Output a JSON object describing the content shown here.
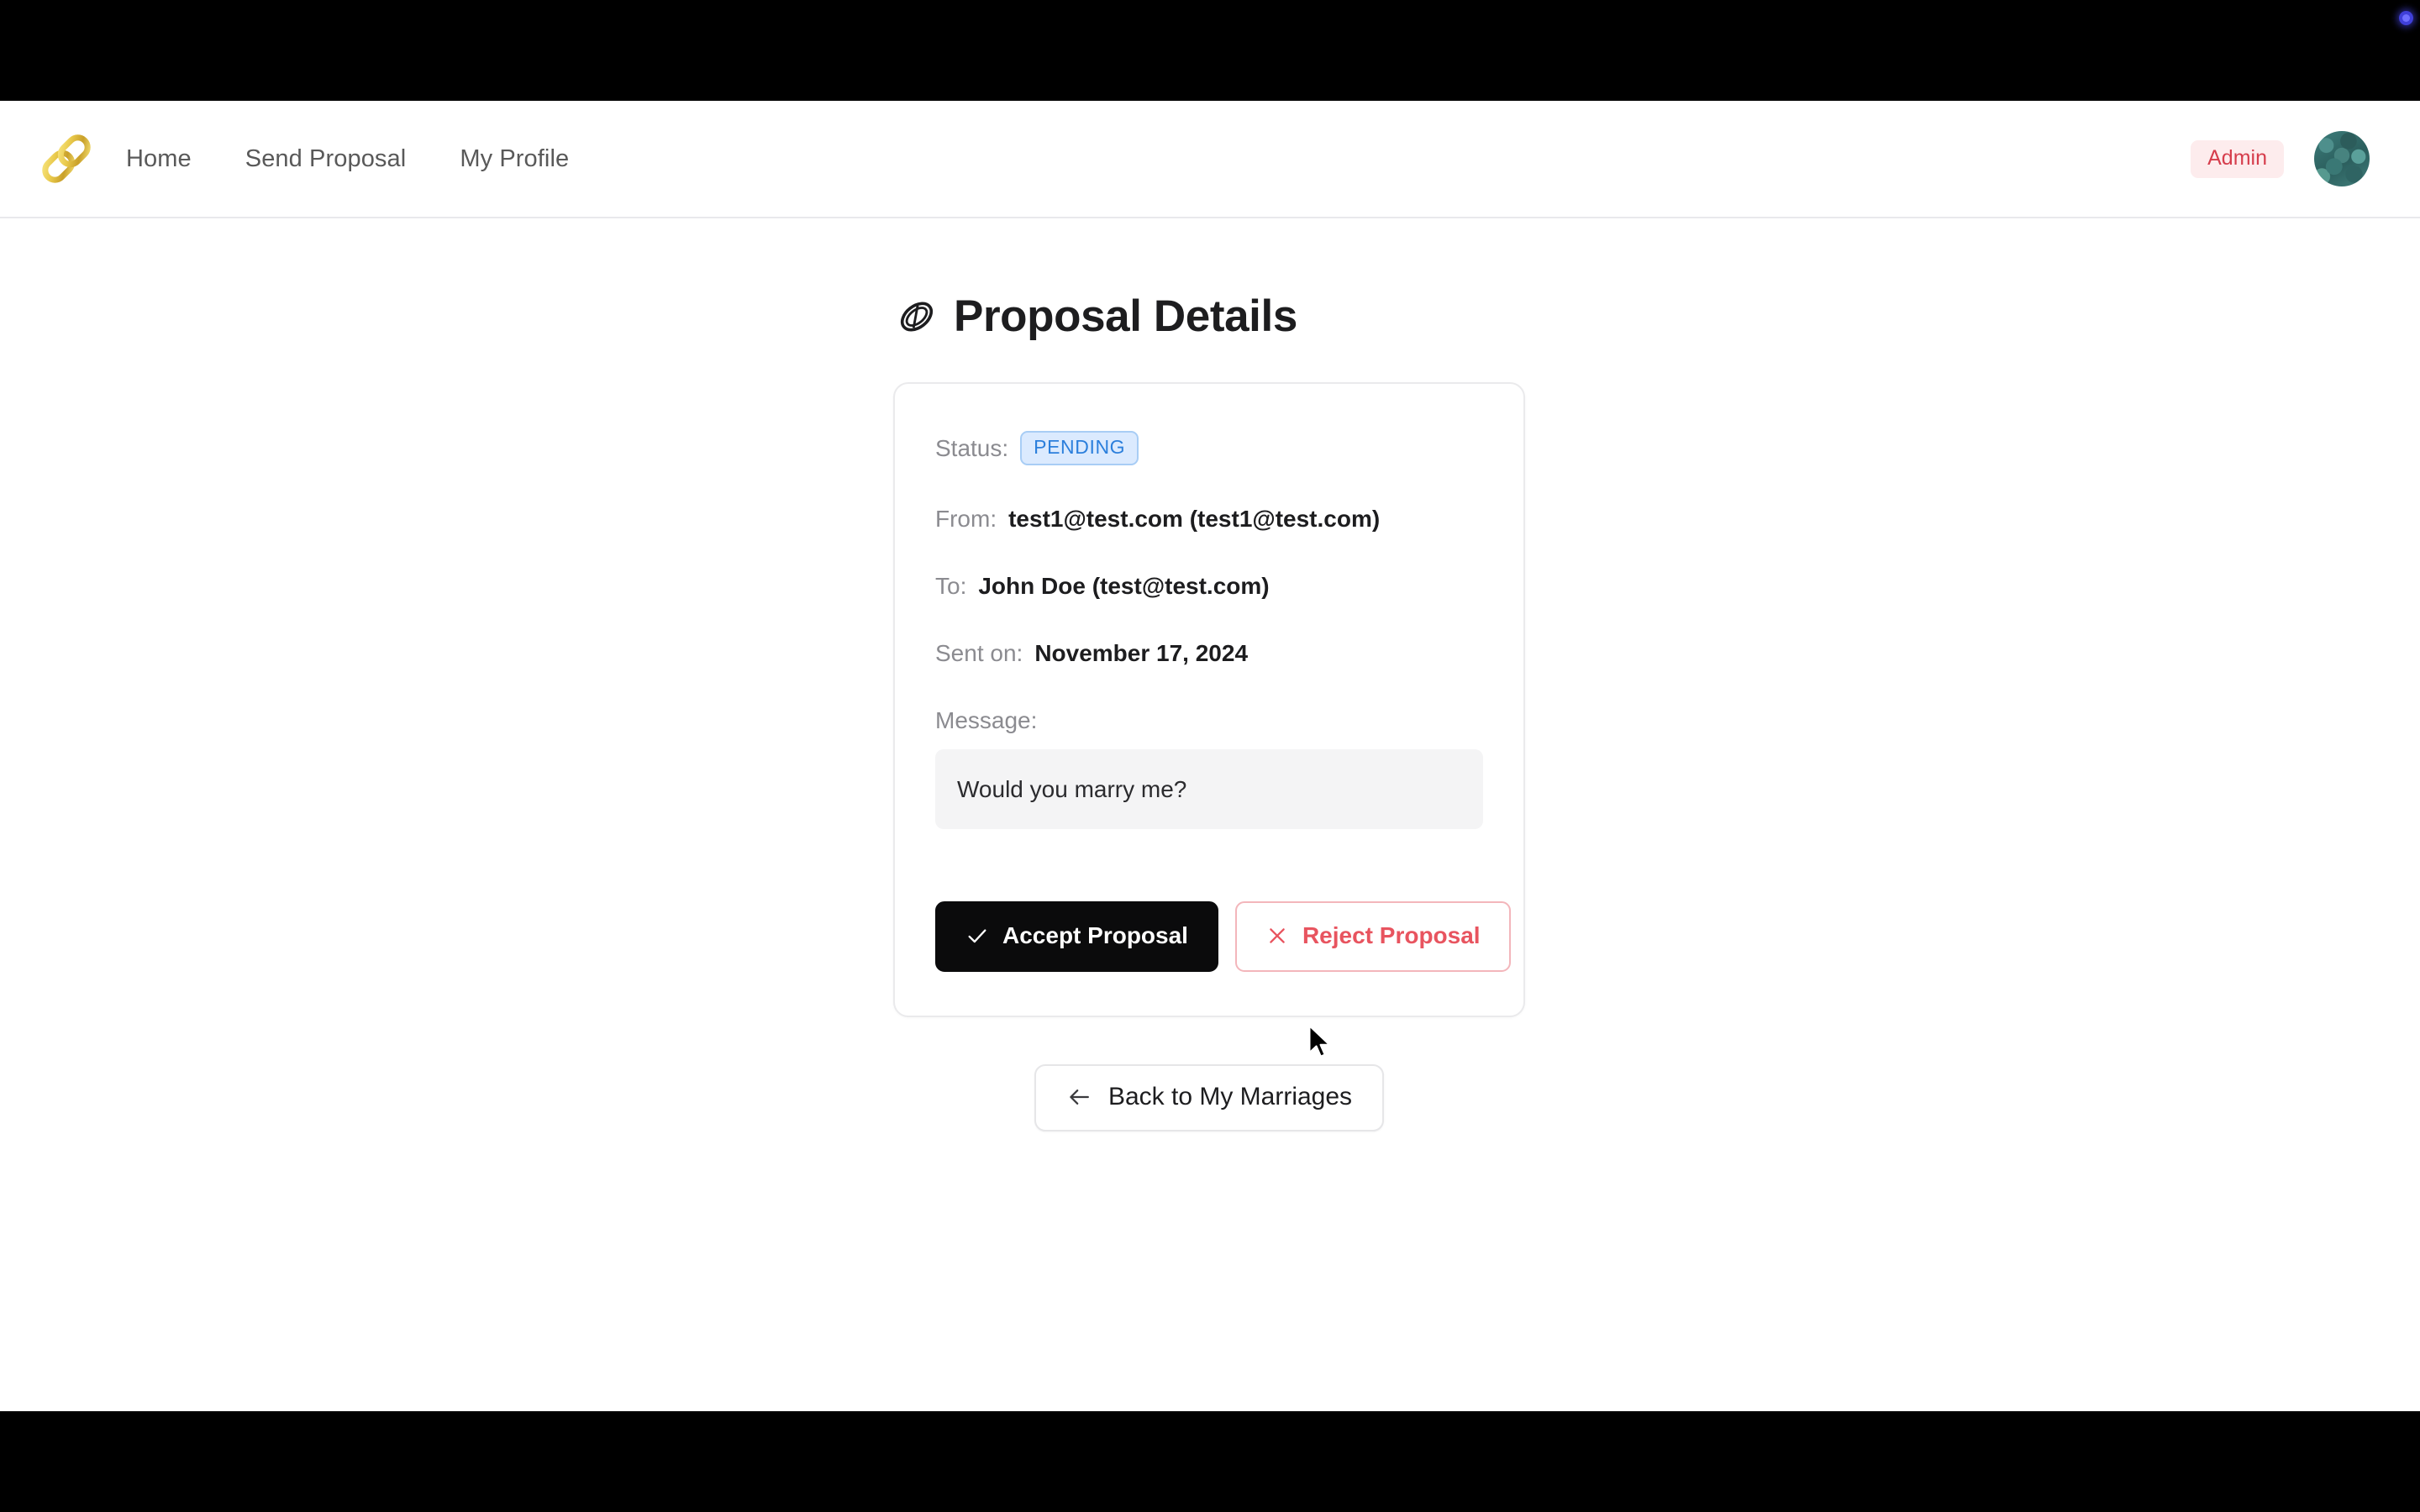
{
  "window": {
    "top_bar_color": "#000000",
    "bottom_bar_color": "#000000",
    "recording_dot_color": "#3f3fd8"
  },
  "navbar": {
    "logo_icon": "chain-link-icon",
    "logo_color": "#d8b13a",
    "links": [
      {
        "label": "Home"
      },
      {
        "label": "Send Proposal"
      },
      {
        "label": "My Profile"
      }
    ],
    "role_badge": {
      "label": "Admin",
      "text_color": "#d63d4c",
      "bg_color": "#fdeced"
    },
    "avatar_icon": "user-avatar"
  },
  "page": {
    "title": "Proposal Details",
    "title_icon": "ring-icon"
  },
  "proposal": {
    "status_label": "Status:",
    "status_value": "PENDING",
    "status_color": "#2b7fdc",
    "status_bg": "#dbeafe",
    "from_label": "From:",
    "from_value": "test1@test.com (test1@test.com)",
    "to_label": "To:",
    "to_value": "John Doe (test@test.com)",
    "sent_label": "Sent on:",
    "sent_value": "November 17, 2024",
    "message_label": "Message:",
    "message_value": "Would you marry me?"
  },
  "actions": {
    "accept_label": "Accept Proposal",
    "accept_icon": "check-icon",
    "reject_label": "Reject Proposal",
    "reject_icon": "close-icon",
    "reject_color": "#e8545f",
    "back_label": "Back to My Marriages",
    "back_icon": "arrow-left-icon"
  }
}
